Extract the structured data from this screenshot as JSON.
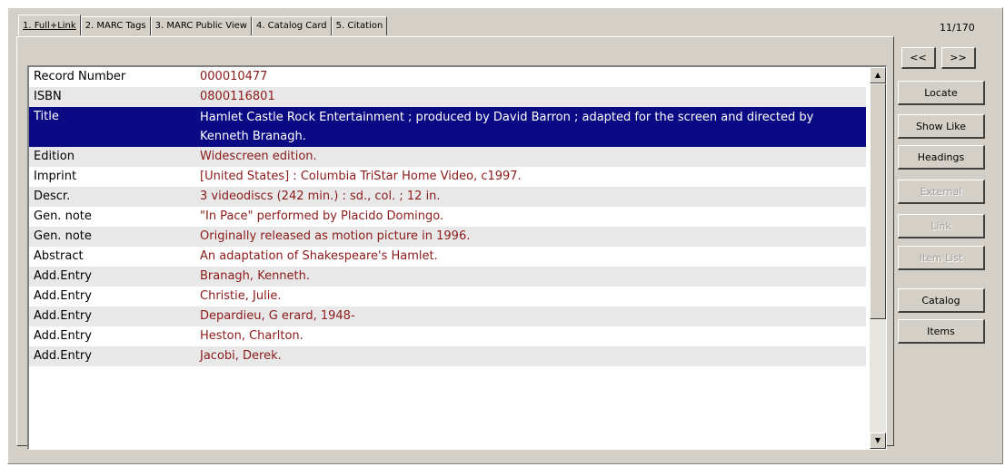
{
  "tabs": [
    {
      "label": "1. Full+Link",
      "active": true
    },
    {
      "label": "2. MARC Tags"
    },
    {
      "label": "3. MARC Public View"
    },
    {
      "label": "4. Catalog Card"
    },
    {
      "label": "5. Citation"
    }
  ],
  "record_counter": "11/170",
  "nav": {
    "prev_label": "<<",
    "next_label": ">>"
  },
  "buttons": {
    "locate": "Locate",
    "show_like": "Show Like",
    "headings": "Headings",
    "external": "External",
    "link": "Link",
    "item_list": "Item List",
    "catalog": "Catalog",
    "items": "Items"
  },
  "scroll_arrows": {
    "up": "▲",
    "down": "▼"
  },
  "records": [
    {
      "label": "Record Number",
      "value": "000010477"
    },
    {
      "label": "ISBN",
      "value": "0800116801"
    },
    {
      "label": "Title",
      "value": "Hamlet Castle Rock Entertainment ; produced by David Barron ; adapted for the screen and directed by Kenneth Branagh.",
      "selected": true
    },
    {
      "label": "Edition",
      "value": "Widescreen edition."
    },
    {
      "label": "Imprint",
      "value": "[United States] : Columbia TriStar Home Video, c1997."
    },
    {
      "label": "Descr.",
      "value": "3 videodiscs (242 min.) :  sd., col. ;  12 in."
    },
    {
      "label": "Gen. note",
      "value": "\"In Pace\" performed by Placido Domingo."
    },
    {
      "label": "Gen. note",
      "value": "Originally released as motion picture in 1996."
    },
    {
      "label": "Abstract",
      "value": "An adaptation of Shakespeare's Hamlet."
    },
    {
      "label": "Add.Entry",
      "value": "Branagh, Kenneth."
    },
    {
      "label": "Add.Entry",
      "value": "Christie, Julie."
    },
    {
      "label": "Add.Entry",
      "value": "Depardieu, G erard, 1948-"
    },
    {
      "label": "Add.Entry",
      "value": "Heston, Charlton."
    },
    {
      "label": "Add.Entry",
      "value": "Jacobi, Derek."
    }
  ]
}
